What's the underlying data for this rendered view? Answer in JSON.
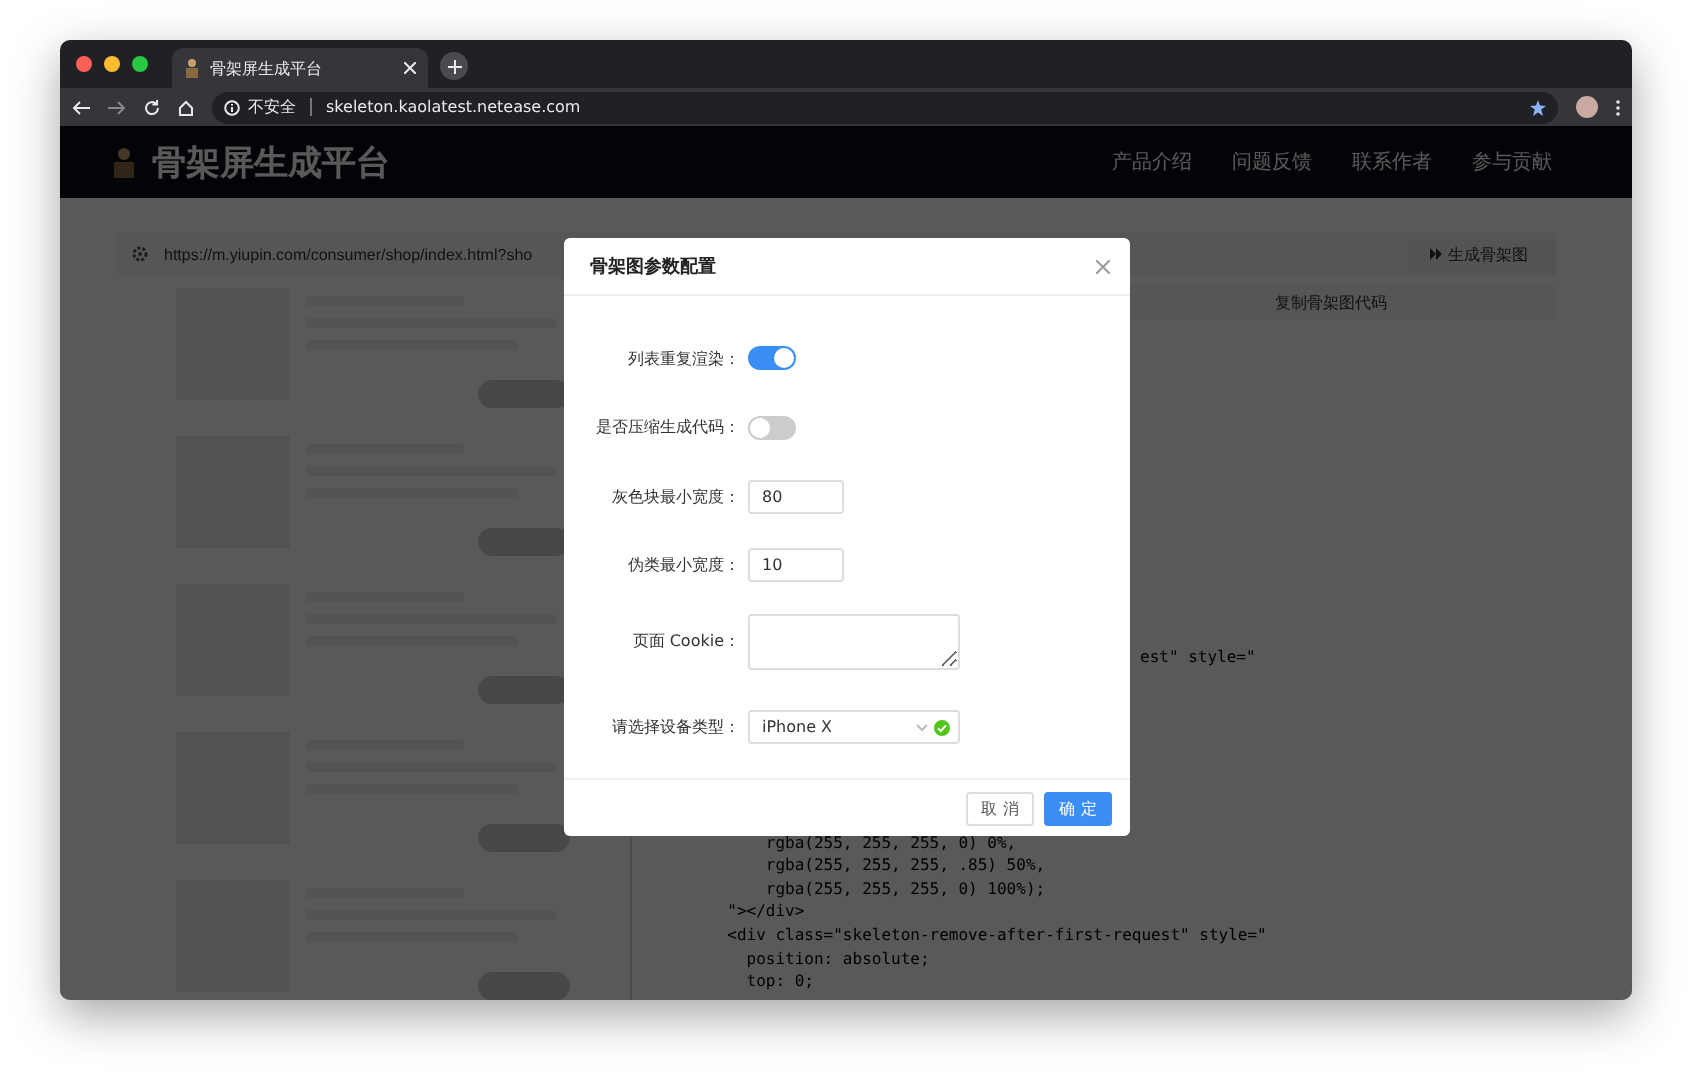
{
  "browser": {
    "tab_title": "骨架屏生成平台",
    "security_label": "不安全",
    "url": "skeleton.kaolatest.netease.com"
  },
  "app": {
    "title": "骨架屏生成平台",
    "nav": [
      {
        "label": "产品介绍"
      },
      {
        "label": "问题反馈"
      },
      {
        "label": "联系作者"
      },
      {
        "label": "参与贡献"
      }
    ]
  },
  "toolbar": {
    "page_url": "https://m.yiupin.com/consumer/shop/index.html?sho",
    "generate_button": "生成骨架图",
    "copy_button": "复制骨架图代码"
  },
  "code_lines": [
    {
      "kind": "cut",
      "text": "est\" style=\""
    },
    {
      "kind": "line",
      "text": "      rgba(255, 255, 255, 0) 0%,"
    },
    {
      "kind": "line",
      "text": "      rgba(255, 255, 255, .85) 50%,"
    },
    {
      "kind": "line",
      "text": "      rgba(255, 255, 255, 0) 100%);"
    },
    {
      "kind": "line",
      "text": "  \"></div>"
    },
    {
      "kind": "line",
      "text": "  <div class=\"skeleton-remove-after-first-request\" style=\""
    },
    {
      "kind": "line",
      "text": "    position: absolute;"
    },
    {
      "kind": "line",
      "text": "    top: 0;"
    }
  ],
  "dialog": {
    "title": "骨架图参数配置",
    "fields": [
      {
        "kind": "switch",
        "label": "列表重复渲染：",
        "on": true
      },
      {
        "kind": "switch",
        "label": "是否压缩生成代码：",
        "on": false
      },
      {
        "kind": "input",
        "label": "灰色块最小宽度：",
        "value": "80"
      },
      {
        "kind": "input",
        "label": "伪类最小宽度：",
        "value": "10"
      },
      {
        "kind": "textarea",
        "label": "页面 Cookie："
      },
      {
        "kind": "select",
        "label": "请选择设备类型：",
        "value": "iPhone X",
        "valid": true
      }
    ],
    "cancel_button": "取 消",
    "confirm_button": "确 定"
  }
}
